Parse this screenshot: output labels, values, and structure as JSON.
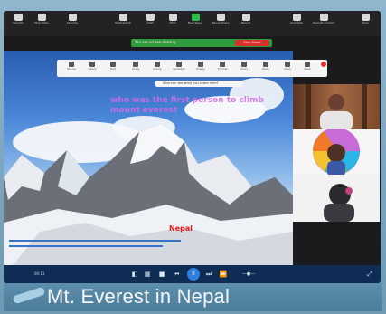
{
  "toolbar": {
    "items": [
      {
        "label": "Security",
        "icon": "shield-icon"
      },
      {
        "label": "Stop Video",
        "icon": "video-camera-icon"
      },
      {
        "label": "Security",
        "icon": "lock-icon"
      },
      {
        "label": "Participants",
        "icon": "people-icon"
      },
      {
        "label": "Chat",
        "icon": "chat-icon"
      },
      {
        "label": "Polls",
        "icon": "poll-icon"
      },
      {
        "label": "New Share",
        "icon": "share-screen-icon"
      },
      {
        "label": "Pause Share",
        "icon": "pause-icon"
      },
      {
        "label": "Record",
        "icon": "record-icon"
      },
      {
        "label": "Annotate",
        "icon": "pencil-icon"
      },
      {
        "label": "Remote Control",
        "icon": "remote-control-icon"
      },
      {
        "label": "More",
        "icon": "more-icon"
      }
    ]
  },
  "share_bar": {
    "text": "You are screen sharing",
    "stop_label": "Stop Share"
  },
  "annotation": {
    "tools": [
      "Mouse",
      "Select",
      "Text",
      "Draw",
      "Stamp",
      "Spotlight",
      "Eraser",
      "Format",
      "Undo",
      "Redo",
      "Clear",
      "Save"
    ],
    "comment_placeholder": "Who can see what you share here?"
  },
  "slide": {
    "pink_note": "who was the first person to climb mount everest",
    "red_note": "Nepal",
    "caption": "Mt. Everest in Nepal"
  },
  "participants": [
    {
      "name": ""
    },
    {
      "name": ""
    },
    {
      "name": ""
    }
  ],
  "controls": {
    "time": "00:11",
    "play_label": "II"
  },
  "colors": {
    "share_green": "#2e9b3c",
    "stop_red": "#d9302c",
    "accent_blue": "#2f7fe0"
  }
}
